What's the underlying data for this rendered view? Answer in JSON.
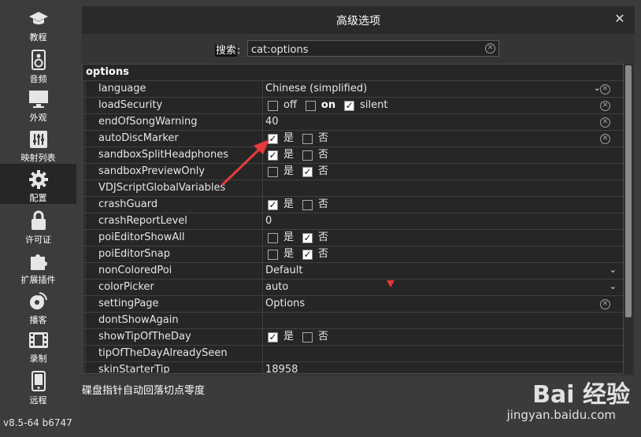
{
  "sidebar": {
    "items": [
      {
        "label": "教程",
        "icon": "graduation-cap-icon"
      },
      {
        "label": "音频",
        "icon": "speaker-icon"
      },
      {
        "label": "外观",
        "icon": "monitor-icon"
      },
      {
        "label": "映射列表",
        "icon": "sliders-icon"
      },
      {
        "label": "配置",
        "icon": "gear-icon"
      },
      {
        "label": "许可证",
        "icon": "lock-icon"
      },
      {
        "label": "扩展插件",
        "icon": "puzzle-icon"
      },
      {
        "label": "播客",
        "icon": "podcast-icon"
      },
      {
        "label": "录制",
        "icon": "film-icon"
      },
      {
        "label": "远程",
        "icon": "phone-icon"
      }
    ],
    "active": "配置",
    "version": "v8.5-64 b6747"
  },
  "dialog": {
    "title": "高级选项",
    "close_symbol": "✕",
    "search_label": "搜索",
    "search_colon": ":",
    "search_value": "cat:options",
    "group_header": "options",
    "rows": [
      {
        "name": "language",
        "type": "dropdown",
        "value": "Chinese (simplified)",
        "clearable": true
      },
      {
        "name": "loadSecurity",
        "type": "tristate",
        "options": [
          "off",
          "on",
          "silent"
        ],
        "checked": [
          false,
          false,
          true
        ],
        "clearable": true
      },
      {
        "name": "endOfSongWarning",
        "type": "text",
        "value": "40",
        "clearable": true
      },
      {
        "name": "autoDiscMarker",
        "type": "yesno",
        "yes": true,
        "no": false,
        "clearable": true
      },
      {
        "name": "sandboxSplitHeadphones",
        "type": "yesno",
        "yes": true,
        "no": false
      },
      {
        "name": "sandboxPreviewOnly",
        "type": "yesno",
        "yes": false,
        "no": true
      },
      {
        "name": "VDJScriptGlobalVariables",
        "type": "text",
        "value": ""
      },
      {
        "name": "crashGuard",
        "type": "yesno",
        "yes": true,
        "no": false
      },
      {
        "name": "crashReportLevel",
        "type": "text",
        "value": "0"
      },
      {
        "name": "poiEditorShowAll",
        "type": "yesno",
        "yes": false,
        "no": true
      },
      {
        "name": "poiEditorSnap",
        "type": "yesno",
        "yes": false,
        "no": true
      },
      {
        "name": "nonColoredPoi",
        "type": "dropdown-wide",
        "value": "Default"
      },
      {
        "name": "colorPicker",
        "type": "dropdown-wide",
        "value": "auto"
      },
      {
        "name": "settingPage",
        "type": "text",
        "value": "Options",
        "clearable": true
      },
      {
        "name": "dontShowAgain",
        "type": "text",
        "value": ""
      },
      {
        "name": "showTipOfTheDay",
        "type": "yesno",
        "yes": true,
        "no": false
      },
      {
        "name": "tipOfTheDayAlreadySeen",
        "type": "text",
        "value": ""
      },
      {
        "name": "skinStarterTip",
        "type": "text",
        "value": "18958"
      }
    ],
    "yes_label": "是",
    "no_label": "否",
    "hint": "碟盘指针自动回落切点零度"
  },
  "watermark": {
    "main": "Bai 经验",
    "sub": "jingyan.baidu.com"
  },
  "colors": {
    "accent_red": "#e63b3b",
    "background": "#3b3b3b",
    "grid": "#262626"
  }
}
